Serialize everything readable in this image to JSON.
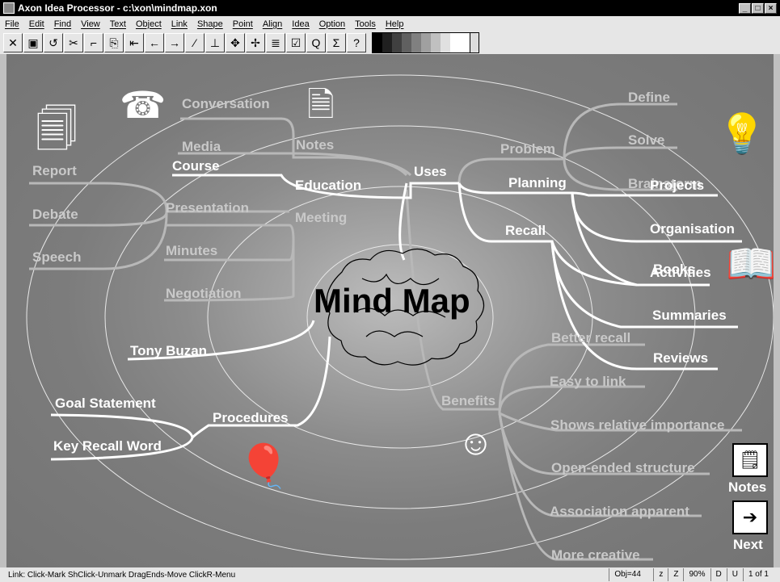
{
  "window": {
    "title": "Axon Idea Processor - c:\\xon\\mindmap.xon"
  },
  "menu": [
    "File",
    "Edit",
    "Find",
    "View",
    "Text",
    "Object",
    "Link",
    "Shape",
    "Point",
    "Align",
    "Idea",
    "Option",
    "Tools",
    "Help"
  ],
  "toolbar_icons": [
    "close-icon",
    "save-icon",
    "undo-icon",
    "cut-icon",
    "link-icon",
    "paste-icon",
    "first-icon",
    "back-icon",
    "forward-icon",
    "wand-icon",
    "align-icon",
    "move-icon",
    "scatter-icon",
    "list-icon",
    "check-icon",
    "query-icon",
    "sigma-icon",
    "help-icon"
  ],
  "palette_colors": [
    "#000000",
    "#202020",
    "#404040",
    "#606060",
    "#808080",
    "#a0a0a0",
    "#c0c0c0",
    "#e0e0e0",
    "#ffffff",
    "#ffffff"
  ],
  "map": {
    "center": "Mind Map",
    "uses": "Uses",
    "notes": "Notes",
    "conversation": "Conversation",
    "media": "Media",
    "course": "Course",
    "education": "Education",
    "report": "Report",
    "debate": "Debate",
    "speech": "Speech",
    "presentation": "Presentation",
    "meeting": "Meeting",
    "minutes": "Minutes",
    "negotiation": "Negotiation",
    "tony_buzan": "Tony Buzan",
    "goal_statement": "Goal Statement",
    "key_recall_word": "Key Recall Word",
    "procedures": "Procedures",
    "problem": "Problem",
    "define": "Define",
    "solve": "Solve",
    "brainstorm": "Brainstorm",
    "planning": "Planning",
    "projects": "Projects",
    "organisation": "Organisation",
    "activities": "Activities",
    "books": "Books",
    "recall": "Recall",
    "summaries": "Summaries",
    "reviews": "Reviews",
    "benefits": "Benefits",
    "better_recall": "Better recall",
    "easy_to_link": "Easy to link",
    "shows_relative_importance": "Shows relative importance",
    "open_ended_structure": "Open-ended structure",
    "association_apparent": "Association apparent",
    "more_creative": "More creative"
  },
  "side": {
    "notes_label": "Notes",
    "next_label": "Next"
  },
  "status": {
    "message": "Link: Click-Mark ShClick-Unmark DragEnds-Move ClickR-Menu",
    "obj": "Obj=44",
    "z_lower": "z",
    "z_upper": "Z",
    "zoom": "90%",
    "d": "D",
    "u": "U",
    "page": "1 of 1"
  }
}
